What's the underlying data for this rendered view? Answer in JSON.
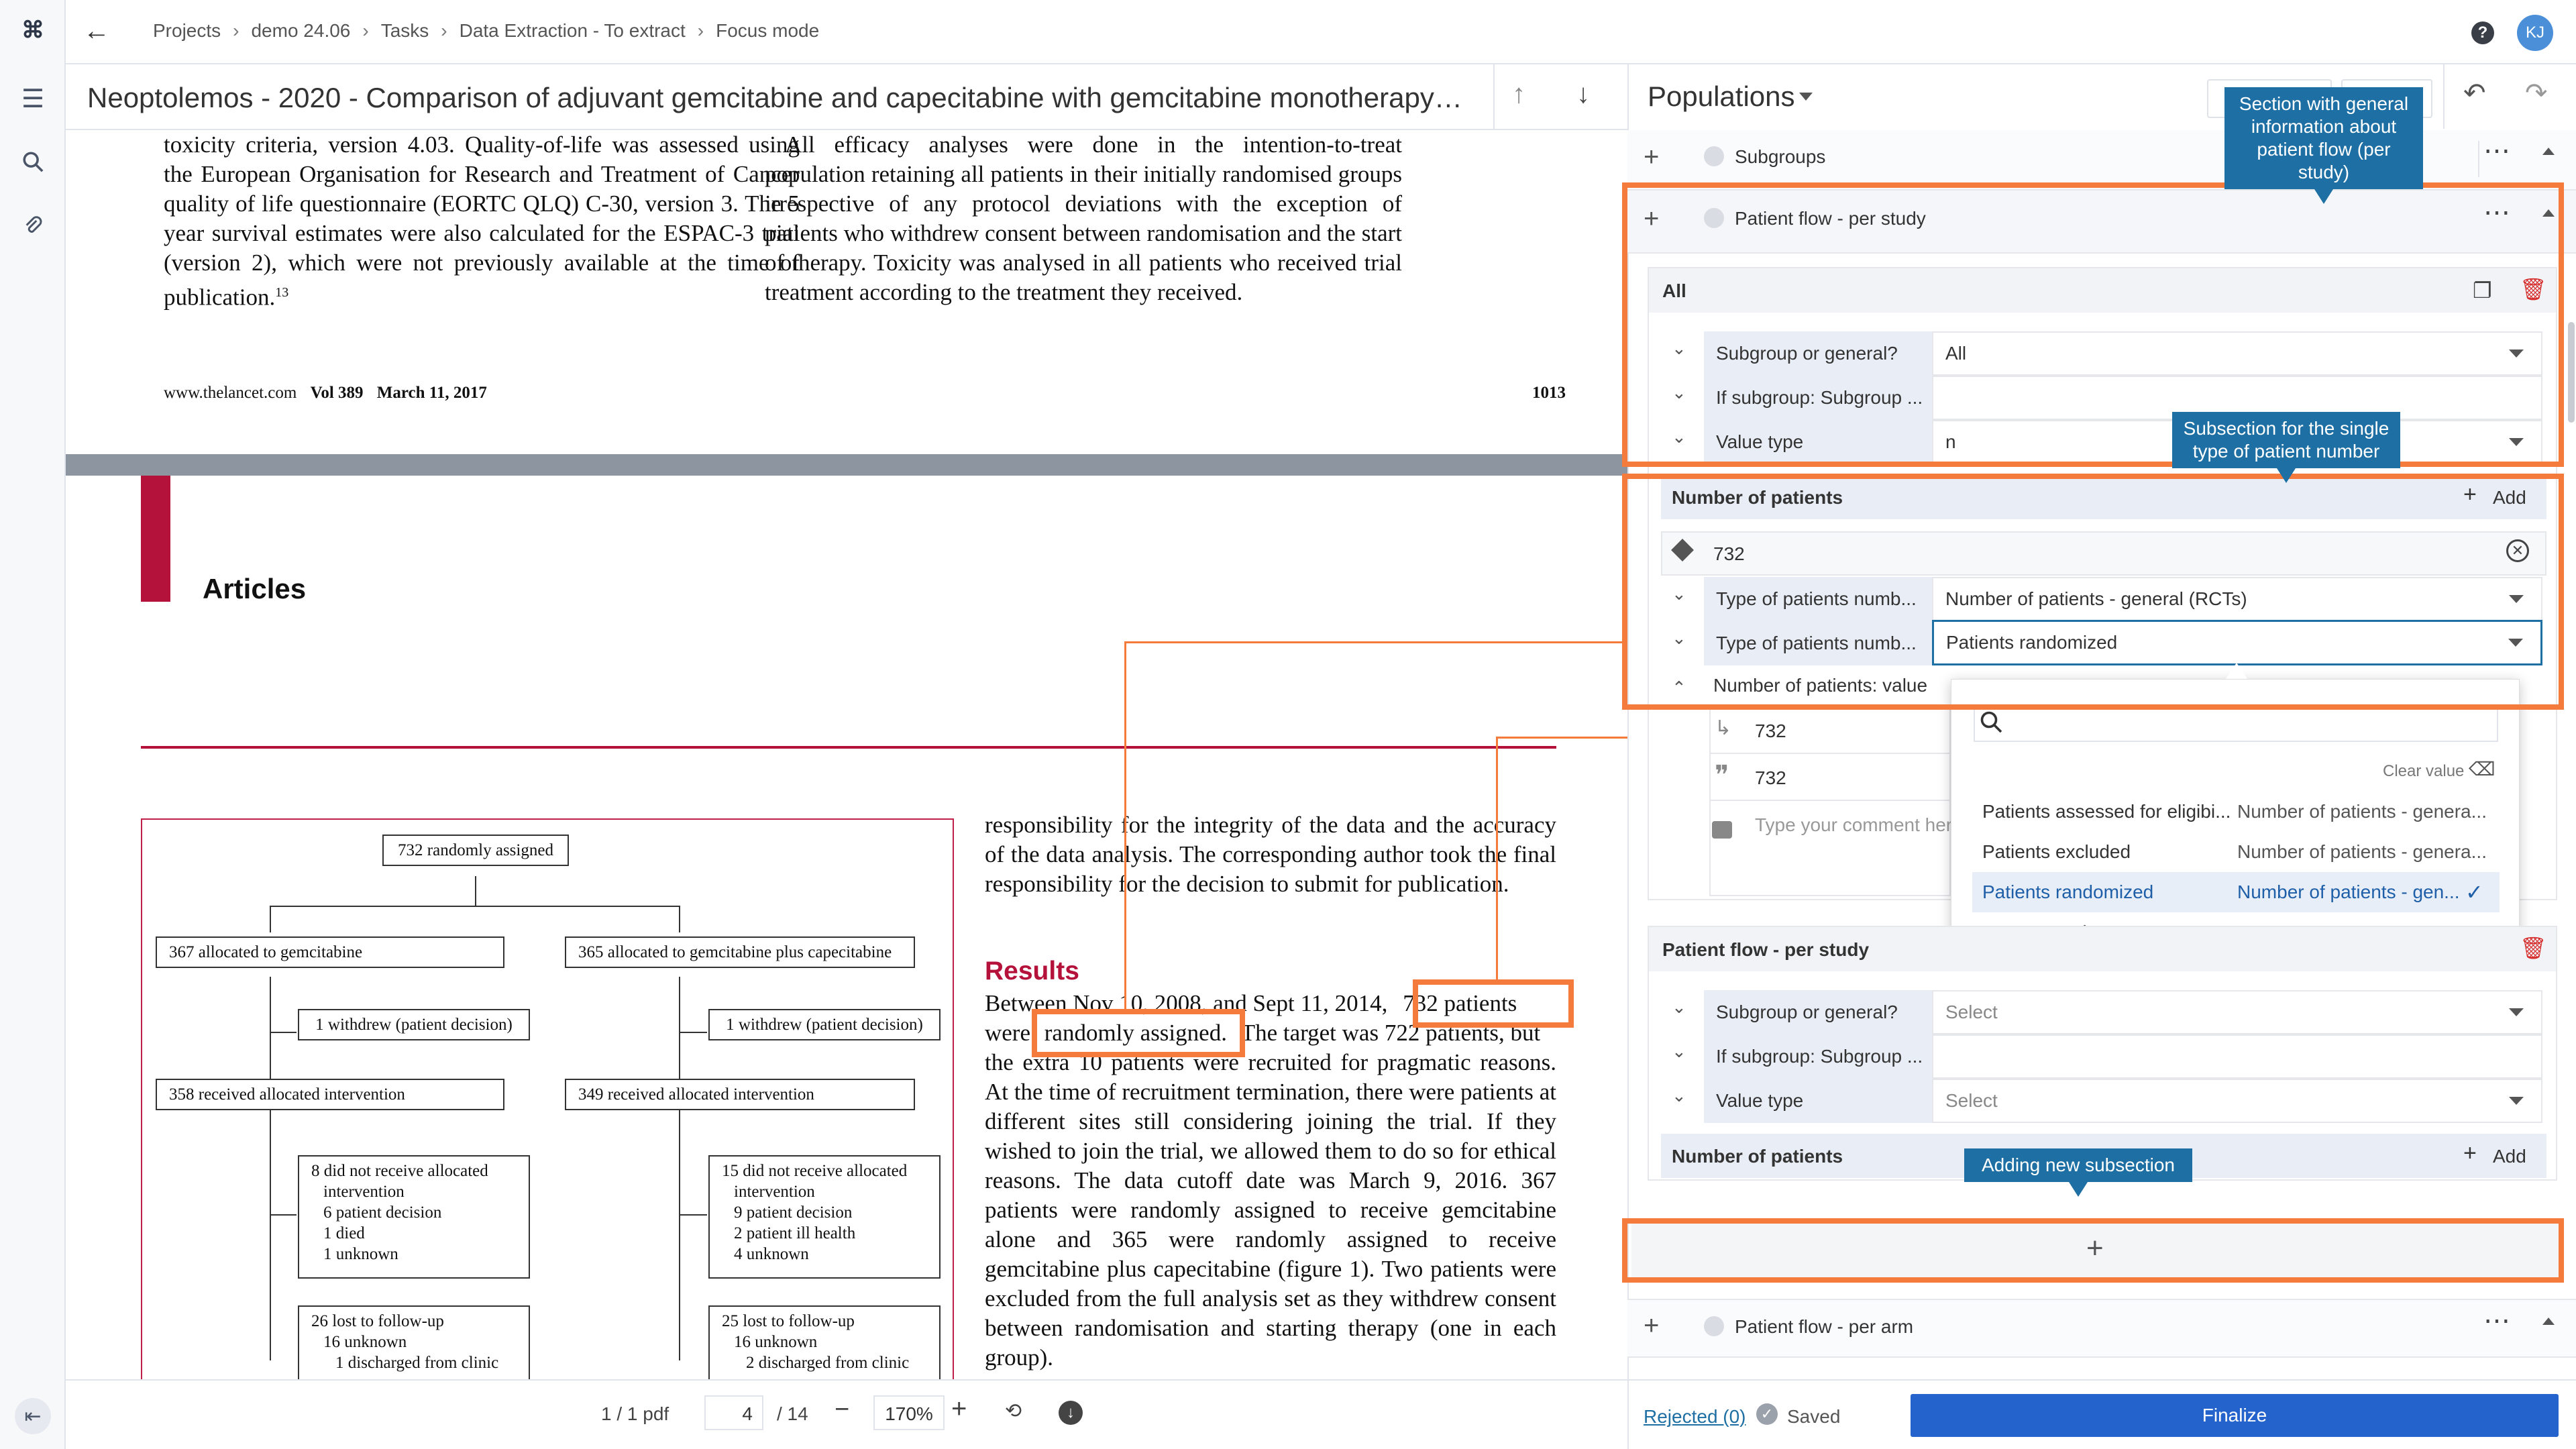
{
  "header": {
    "breadcrumbs": [
      "Projects",
      "demo 24.06",
      "Tasks",
      "Data Extraction - To extract",
      "Focus mode"
    ],
    "user_initials": "KJ",
    "help_label": "?"
  },
  "document": {
    "title": "Neoptolemos - 2020 - Comparison of adjuvant gemcitabine and capecitabine with gemcitabine monotherapy in pa..."
  },
  "pdf": {
    "top_left_paragraph": "toxicity criteria, version 4.03. Quality-of-life was assessed using the European Organisation for Research and Treatment of Cancer quality of life questionnaire (EORTC QLQ) C-30, version 3. The 5 year survival estimates were also calculated for the ESPAC-3 trial (version 2), which were not previously available at the time of publication.",
    "top_left_sup": "13",
    "top_right_paragraph": "All efficacy analyses were done in the intention-to-treat population retaining all patients in their initially randomised groups irrespective of any protocol deviations with the exception of patients who withdrew consent between randomisation and the start of therapy. Toxicity was analysed in all patients who received trial treatment according to the treatment they received.",
    "footer_left": "www.thelancet.com",
    "footer_vol": "Vol 389",
    "footer_date": "March 11, 2017",
    "footer_page": "1013",
    "section_heading": "Articles",
    "right_col_para1": "responsibility for the integrity of the data and the accuracy of the data analysis. The corresponding author took the final responsibility for the decision to submit for publication.",
    "results_heading": "Results",
    "results_line1_pre": "Between Nov 10, 2008, and Sept 11, 2014,",
    "results_highlight1": "732 patients",
    "results_line2_pre": "were",
    "results_highlight2": "randomly assigned.",
    "results_line2_post": "The target was 722 patients, but",
    "results_rest": "the extra 10 patients were recruited for pragmatic reasons. At the time of recruitment termination, there were patients at different sites still considering joining the trial. If they wished to join the trial, we allowed them to do so for ethical reasons. The data cutoff date was March 9, 2016. 367 patients were randomly assigned to receive gemcitabine alone and 365 were randomly assigned to receive gemcitabine plus capecitabine (figure 1). Two patients were excluded from the full analysis set as they withdrew consent between randomisation and starting therapy (one in each group).",
    "flow": {
      "top": "732 randomly assigned",
      "left_alloc": "367 allocated to gemcitabine",
      "right_alloc": "365 allocated to gemcitabine plus capecitabine",
      "left_withdrew": "1 withdrew (patient decision)",
      "right_withdrew": "1 withdrew (patient decision)",
      "left_received": "358 received allocated intervention",
      "right_received": "349 received allocated intervention",
      "left_not_received": [
        "8 did not receive allocated",
        "intervention",
        "6 patient decision",
        "1 died",
        "1 unknown"
      ],
      "right_not_received": [
        "15 did not receive allocated",
        "intervention",
        "9 patient decision",
        "2 patient ill health",
        "4 unknown"
      ],
      "left_lost": [
        "26 lost to follow-up",
        "16 unknown",
        "1 discharged from clinic"
      ],
      "right_lost": [
        "25 lost to follow-up",
        "16 unknown",
        "2 discharged from clinic"
      ]
    }
  },
  "pdf_toolbar": {
    "file_count": "1 / 1 pdf",
    "page_current": "4",
    "page_total": "/ 14",
    "zoom": "170%"
  },
  "panel": {
    "section_title": "Populations",
    "groups": {
      "subgroups": "Subgroups",
      "patient_flow_study": "Patient flow - per study",
      "patient_flow_arm": "Patient flow - per arm"
    },
    "card1": {
      "title": "All",
      "rows": [
        {
          "label": "Subgroup or general?",
          "value": "All"
        },
        {
          "label": "If subgroup: Subgroup ...",
          "value": ""
        },
        {
          "label": "Value type",
          "value": "n"
        }
      ],
      "number_header": "Number of patients",
      "add_label": "Add",
      "entry_value": "732",
      "type_rows": [
        {
          "label": "Type of patients numb...",
          "value": "Number of patients - general (RCTs)"
        },
        {
          "label": "Type of patients numb...",
          "value": "Patients randomized"
        }
      ],
      "value_label": "Number of patients: value",
      "value_entry": "732",
      "quote_entry": "732",
      "comment_placeholder": "Type your comment her"
    },
    "dropdown": {
      "search_placeholder": "",
      "clear_label": "Clear value",
      "options": [
        {
          "name": "Patients assessed for eligibi...",
          "category": "Number of patients - genera..."
        },
        {
          "name": "Patients excluded",
          "category": "Number of patients - genera..."
        },
        {
          "name": "Patients randomized",
          "category": "Number of patients - gen...",
          "selected": true
        },
        {
          "name": "Not reported",
          "category": ""
        }
      ]
    },
    "card2": {
      "title": "Patient flow - per study",
      "rows": [
        {
          "label": "Subgroup or general?",
          "value": "Select"
        },
        {
          "label": "If subgroup: Subgroup ...",
          "value": ""
        },
        {
          "label": "Value type",
          "value": "Select"
        }
      ],
      "number_header": "Number of patients",
      "add_label": "Add"
    },
    "footer": {
      "rejected": "Rejected (0)",
      "saved": "Saved",
      "finalize": "Finalize"
    }
  },
  "annotations": {
    "tip_section": "Section with general information about patient flow (per study)",
    "tip_subsection": "Subsection for the single type of patient number",
    "tip_add": "Adding new subsection"
  },
  "colors": {
    "accent_blue": "#1e6fa3",
    "finalize_blue": "#2463cc",
    "highlight_orange": "#f47b3c",
    "lancet_red": "#b5123b"
  }
}
